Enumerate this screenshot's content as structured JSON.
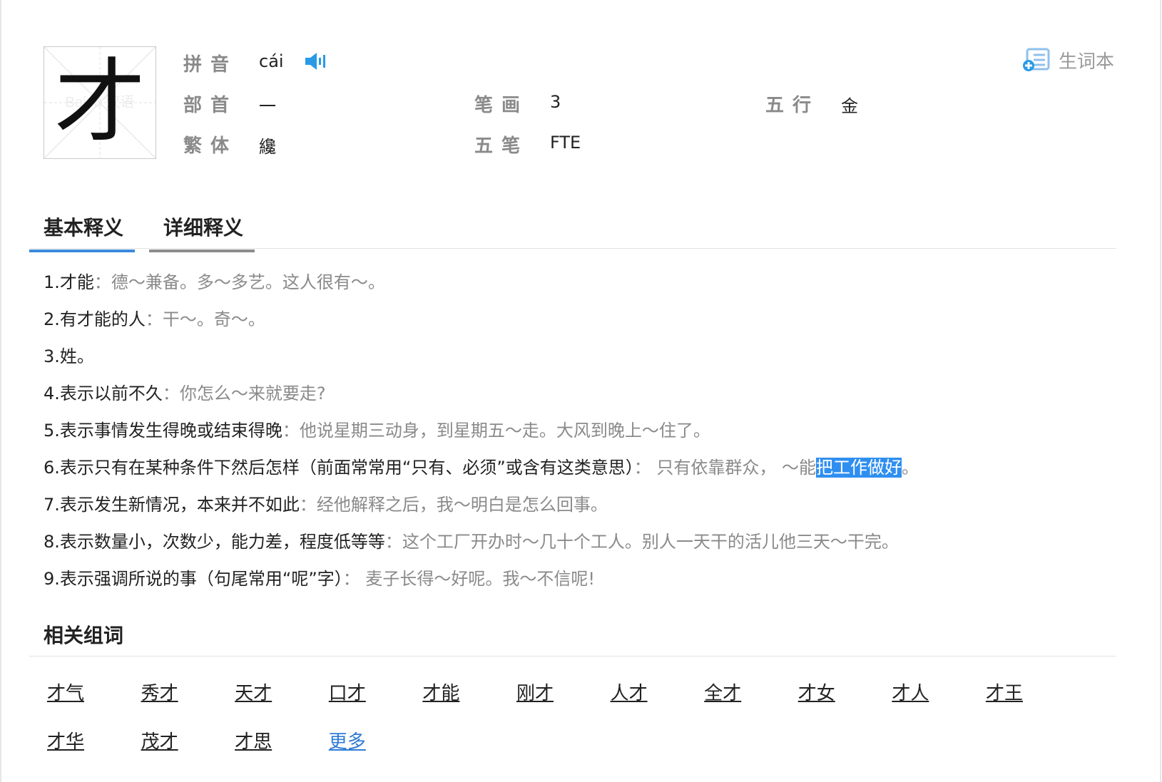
{
  "entry": {
    "character": "才",
    "watermark": "Baidu 汉语",
    "pinyin_label": "拼音",
    "pinyin": "cái",
    "radical_label": "部首",
    "radical": "一",
    "strokes_label": "笔画",
    "strokes": "3",
    "wuxing_label": "五行",
    "wuxing": "金",
    "traditional_label": "繁体",
    "traditional": "纔",
    "wubi_label": "五笔",
    "wubi": "FTE"
  },
  "vocab_book": {
    "label": "生词本"
  },
  "tabs": [
    {
      "label": "基本释义",
      "active": true
    },
    {
      "label": "详细释义",
      "active": false
    }
  ],
  "definitions": [
    {
      "term": "1.才能",
      "sep": "：",
      "example": "德～兼备。多～多艺。这人很有～。"
    },
    {
      "term": "2.有才能的人",
      "sep": "：",
      "example": "干～。奇～。"
    },
    {
      "term": "3.姓。",
      "sep": "",
      "example": ""
    },
    {
      "term": "4.表示以前不久",
      "sep": "：",
      "example": "你怎么～来就要走?"
    },
    {
      "term": "5.表示事情发生得晚或结束得晚",
      "sep": "：",
      "example": "他说星期三动身，到星期五～走。大风到晚上～住了。"
    },
    {
      "term": "6.表示只有在某种条件下然后怎样（前面常常用“只有、必须”或含有这类意思）",
      "sep": "：",
      "example": " 只有依靠群众， ～能",
      "highlight": "把工作做好",
      "example_tail": "。"
    },
    {
      "term": "7.表示发生新情况，本来并不如此",
      "sep": "：",
      "example": "经他解释之后，我～明白是怎么回事。"
    },
    {
      "term": "8.表示数量小，次数少，能力差，程度低等等",
      "sep": "：",
      "example": "这个工厂开办时～几十个工人。别人一天干的活儿他三天～干完。"
    },
    {
      "term": "9.表示强调所说的事（句尾常用“呢”字）",
      "sep": "：",
      "example": " 麦子长得～好呢。我～不信呢!"
    }
  ],
  "related": {
    "title": "相关组词",
    "words": [
      "才气",
      "秀才",
      "天才",
      "口才",
      "才能",
      "刚才",
      "人才",
      "全才",
      "才女",
      "才人",
      "才王",
      "才华",
      "茂才",
      "才思"
    ],
    "more_label": "更多"
  },
  "colors": {
    "accent": "#3a8bdc",
    "highlight": "#2f8ff0",
    "example_text": "#8a8a8a",
    "speaker": "#2a9ae6"
  },
  "icons": {
    "speaker": "speaker-icon",
    "vocab": "vocab-book-icon"
  }
}
